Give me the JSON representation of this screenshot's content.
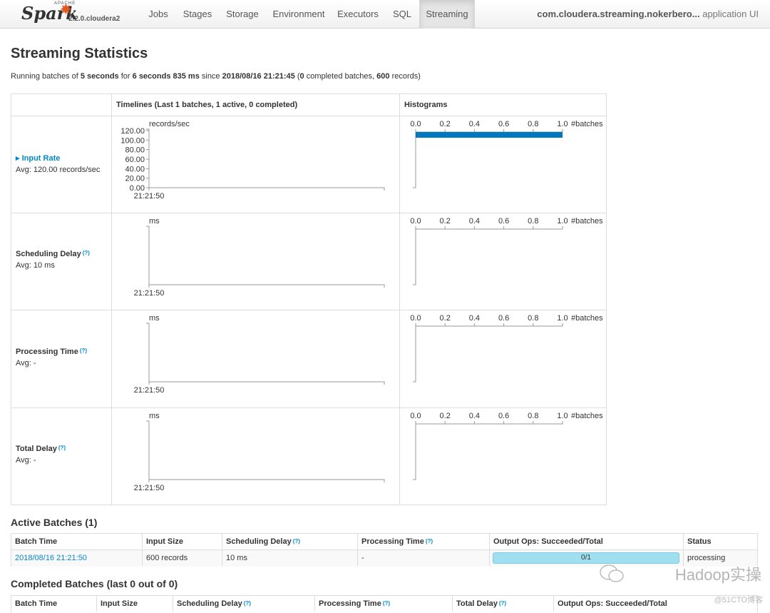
{
  "navbar": {
    "brand_apache": "APACHE",
    "brand_name": "Spark",
    "version": "2.2.0.cloudera2",
    "tabs": [
      {
        "label": "Jobs"
      },
      {
        "label": "Stages"
      },
      {
        "label": "Storage"
      },
      {
        "label": "Environment"
      },
      {
        "label": "Executors"
      },
      {
        "label": "SQL"
      },
      {
        "label": "Streaming",
        "active": true
      }
    ],
    "app_name": "com.cloudera.streaming.nokerbero...",
    "app_suffix": "application UI"
  },
  "page_title": "Streaming Statistics",
  "summary": {
    "prefix": "Running batches of",
    "batch_interval": "5 seconds",
    "for_word": "for",
    "duration": "6 seconds 835 ms",
    "since_word": "since",
    "start_time": "2018/08/16 21:21:45",
    "completed_count": "0",
    "completed_label": "completed batches,",
    "records": "600",
    "records_label": "records)"
  },
  "stats": {
    "col_timelines": "Timelines (Last 1 batches, 1 active, 0 completed)",
    "col_histograms": "Histograms",
    "help_mark": "(?)",
    "hist_ticks": [
      "0.0",
      "0.2",
      "0.4",
      "0.6",
      "0.8",
      "1.0"
    ],
    "hist_unit": "#batches",
    "time_tick": "21:21:50",
    "rows": [
      {
        "name": "Input Rate",
        "avg": "Avg: 120.00 records/sec",
        "unit": "records/sec",
        "y_ticks": [
          "120.00",
          "100.00",
          "80.00",
          "60.00",
          "40.00",
          "20.00",
          "0.00"
        ],
        "hist_fraction": 1.0
      },
      {
        "name": "Scheduling Delay",
        "avg": "Avg: 10 ms",
        "unit": "ms",
        "hist_fraction": 0.0
      },
      {
        "name": "Processing Time",
        "avg": "Avg: -",
        "unit": "ms",
        "hist_fraction": 0.0
      },
      {
        "name": "Total Delay",
        "avg": "Avg: -",
        "unit": "ms",
        "hist_fraction": 0.0
      }
    ]
  },
  "active_batches": {
    "title": "Active Batches (1)",
    "headers": [
      "Batch Time",
      "Input Size",
      "Scheduling Delay",
      "Processing Time",
      "Output Ops: Succeeded/Total",
      "Status"
    ],
    "rows": [
      {
        "batch_time": "2018/08/16 21:21:50",
        "input_size": "600 records",
        "scheduling_delay": "10 ms",
        "processing_time": "-",
        "output_ops": "0/1",
        "output_fraction": 1.0,
        "status": "processing"
      }
    ]
  },
  "completed_batches": {
    "title": "Completed Batches (last 0 out of 0)",
    "headers": [
      "Batch Time",
      "Input Size",
      "Scheduling Delay",
      "Processing Time",
      "Total Delay",
      "Output Ops: Succeeded/Total"
    ]
  },
  "watermark": {
    "text": "Hadoop实操",
    "sub": "@51CTO博客"
  },
  "colors": {
    "accent": "#0088cc",
    "histogram_bar": "#0078c0",
    "progress": "#a0dff0"
  }
}
